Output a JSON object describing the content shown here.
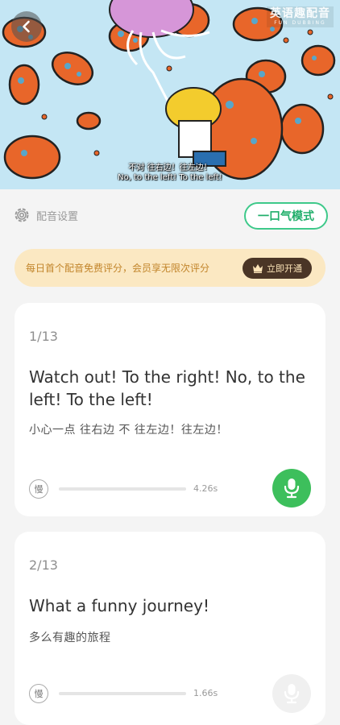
{
  "video": {
    "subtitle_zh": "不对 往右边！往左边！",
    "subtitle_en": "No, to the left! To the left!",
    "watermark_main": "英语趣配音",
    "watermark_sub": "FUN DUBBING",
    "back_icon": "chevron-left-icon"
  },
  "settings": {
    "dub_settings_label": "配音设置",
    "dub_settings_icon": "gear-icon",
    "one_breath_label": "一口气模式"
  },
  "promo": {
    "text": "每日首个配音免费评分，会员享无限次评分",
    "button_label": "立即开通",
    "button_icon": "crown-icon"
  },
  "colors": {
    "accent_green": "#3dbf5c",
    "promo_bg": "#fbe8c2",
    "promo_text": "#c2852b",
    "promo_button_bg": "#4a3526"
  },
  "sentences": [
    {
      "index": "1/13",
      "english": "Watch out! To the right! No, to the left! To the left!",
      "chinese": "小心一点 往右边 不 往左边！往左边！",
      "slow_label": "慢",
      "duration": "4.26s",
      "record_icon": "microphone-icon",
      "record_active": true,
      "progress": 0
    },
    {
      "index": "2/13",
      "english": "What a funny journey!",
      "chinese": "多么有趣的旅程",
      "slow_label": "慢",
      "duration": "1.66s",
      "record_icon": "microphone-icon",
      "record_active": false,
      "progress": 0
    }
  ]
}
